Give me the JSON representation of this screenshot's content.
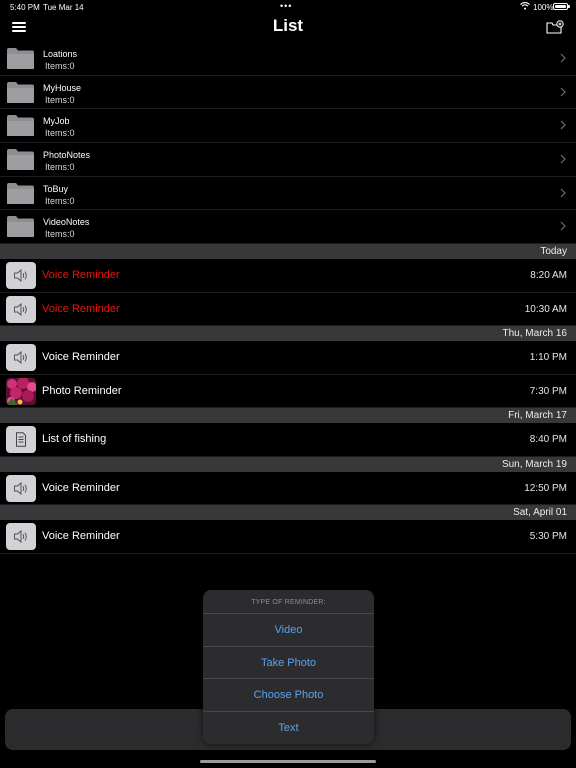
{
  "status_bar": {
    "time": "5:40 PM",
    "date": "Tue Mar 14",
    "dots": "•••",
    "battery": "100%"
  },
  "nav": {
    "title": "List"
  },
  "folders": [
    {
      "name": "Loations",
      "count": "Items:0"
    },
    {
      "name": "MyHouse",
      "count": "Items:0"
    },
    {
      "name": "MyJob",
      "count": "Items:0"
    },
    {
      "name": "PhotoNotes",
      "count": "Items:0"
    },
    {
      "name": "ToBuy",
      "count": "Items:0"
    },
    {
      "name": "VideoNotes",
      "count": "Items:0"
    }
  ],
  "sections": [
    {
      "header": "Today",
      "items": [
        {
          "title": "Voice Reminder",
          "time": "8:20 AM",
          "type": "voice",
          "overdue": true
        },
        {
          "title": "Voice Reminder",
          "time": "10:30 AM",
          "type": "voice",
          "overdue": true
        }
      ]
    },
    {
      "header": "Thu, March 16",
      "items": [
        {
          "title": "Voice Reminder",
          "time": "1:10 PM",
          "type": "voice",
          "overdue": false
        },
        {
          "title": "Photo Reminder",
          "time": "7:30 PM",
          "type": "photo",
          "overdue": false
        }
      ]
    },
    {
      "header": "Fri, March 17",
      "items": [
        {
          "title": "List of fishing",
          "time": "8:40 PM",
          "type": "text",
          "overdue": false
        }
      ]
    },
    {
      "header": "Sun, March 19",
      "items": [
        {
          "title": "Voice Reminder",
          "time": "12:50 PM",
          "type": "voice",
          "overdue": false
        }
      ]
    },
    {
      "header": "Sat, April 01",
      "items": [
        {
          "title": "Voice Reminder",
          "time": "5:30 PM",
          "type": "voice",
          "overdue": false
        }
      ]
    }
  ],
  "popover": {
    "header": "TYPE OF REMINDER:",
    "options": [
      "Video",
      "Take Photo",
      "Choose Photo",
      "Text"
    ]
  },
  "colors": {
    "overdue": "#e2170f",
    "action_blue": "#5aa1f0",
    "section_bg": "#38383a"
  },
  "icons": {
    "folder": "folder-icon",
    "voice": "speaker-icon",
    "text": "document-icon",
    "photo": "photo-thumbnail",
    "chevron": "chevron-right-icon"
  }
}
